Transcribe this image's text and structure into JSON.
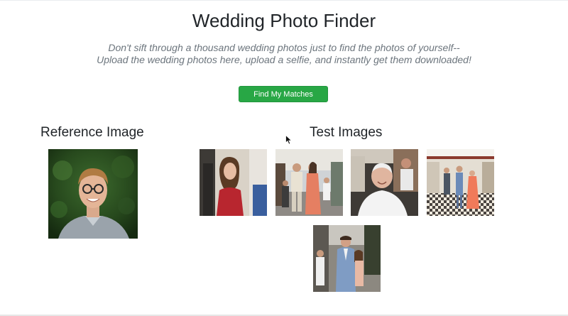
{
  "header": {
    "title": "Wedding Photo Finder",
    "subtitle_line1": "Don't sift through a thousand wedding photos just to find the photos of yourself--",
    "subtitle_line2": "Upload the wedding photos here, upload a selfie, and instantly get them downloaded!"
  },
  "actions": {
    "find_matches_label": "Find My Matches"
  },
  "reference": {
    "heading": "Reference Image"
  },
  "test": {
    "heading": "Test Images"
  },
  "colors": {
    "button_green": "#28a745",
    "subtitle_gray": "#6c757d",
    "text": "#212529"
  },
  "icons": {
    "cursor": "mouse-pointer-icon"
  }
}
